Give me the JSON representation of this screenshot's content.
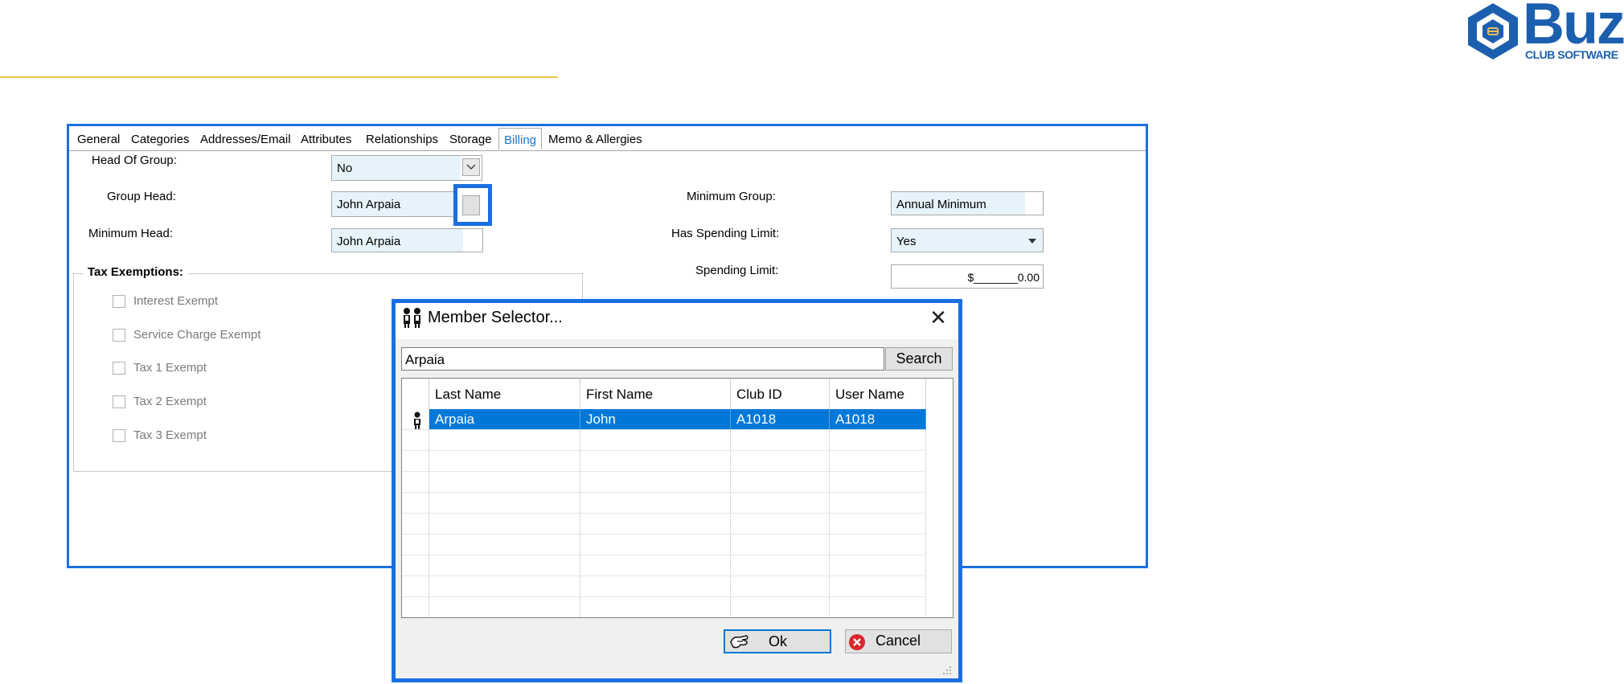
{
  "logo": {
    "word": "Buz",
    "subtitle": "CLUB SOFTWARE",
    "color": "#1b5fae"
  },
  "tabs": [
    {
      "label": "General"
    },
    {
      "label": "Categories"
    },
    {
      "label": "Addresses/Email"
    },
    {
      "label": "Attributes"
    },
    {
      "label": "Relationships"
    },
    {
      "label": "Storage"
    },
    {
      "label": "Billing",
      "active": true
    },
    {
      "label": "Memo & Allergies"
    }
  ],
  "billing": {
    "head_of_group_label": "Head Of Group:",
    "head_of_group_value": "No",
    "group_head_label": "Group Head:",
    "group_head_value": "John Arpaia",
    "minimum_head_label": "Minimum Head:",
    "minimum_head_value": "John Arpaia",
    "minimum_group_label": "Minimum Group:",
    "minimum_group_value": "Annual Minimum",
    "has_spending_limit_label": "Has Spending Limit:",
    "has_spending_limit_value": "Yes",
    "spending_limit_label": "Spending Limit:",
    "spending_limit_value": "$_______0.00"
  },
  "tax_exemptions": {
    "title": "Tax Exemptions:",
    "items": [
      {
        "label": "Interest Exempt",
        "checked": false
      },
      {
        "label": "Service Charge Exempt",
        "checked": false
      },
      {
        "label": "Tax 1 Exempt",
        "checked": false
      },
      {
        "label": "Tax 2 Exempt",
        "checked": false
      },
      {
        "label": "Tax 3 Exempt",
        "checked": false
      }
    ]
  },
  "dialog": {
    "title": "Member Selector...",
    "close_glyph": "✕",
    "search_value": "Arpaia",
    "search_button": "Search",
    "columns": [
      "Last Name",
      "First Name",
      "Club ID",
      "User Name"
    ],
    "rows": [
      {
        "last_name": "Arpaia",
        "first_name": "John",
        "club_id": "A1018",
        "user_name": "A1018",
        "selected": true
      }
    ],
    "ok_button": "Ok",
    "cancel_button": "Cancel"
  },
  "colors": {
    "highlight_border": "#1a6fe0",
    "selection": "#0078d7",
    "accent_rule": "#f2c14e",
    "field_tint": "#e6f3fb"
  },
  "icons": [
    "logo-icon",
    "dropdown-chevron-icon",
    "dropdown-arrow-icon",
    "members-icon",
    "member-row-icon",
    "close-icon",
    "ok-hand-icon",
    "cancel-x-icon",
    "resize-grip-icon"
  ]
}
